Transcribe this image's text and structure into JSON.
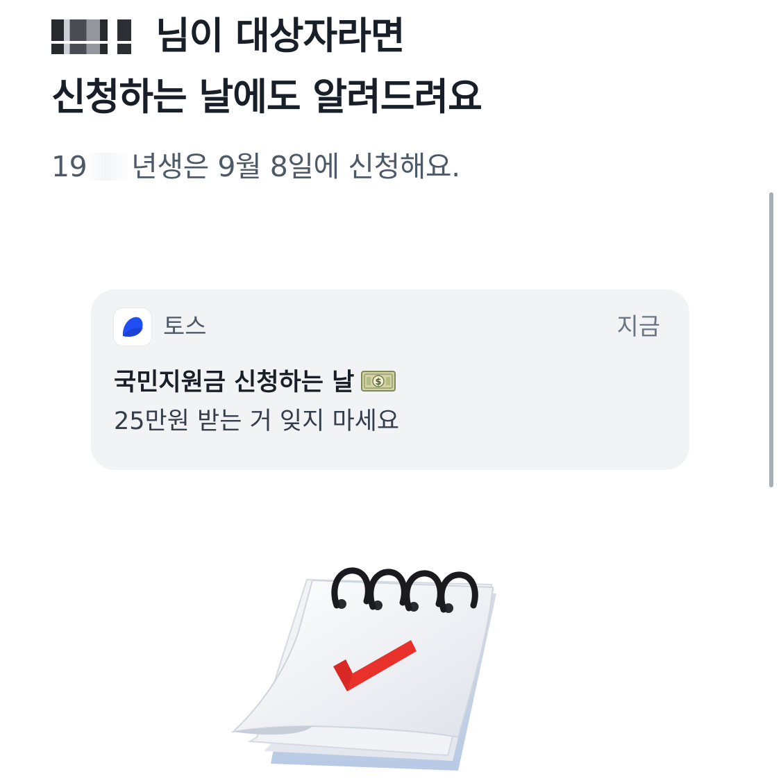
{
  "header": {
    "name_suffix": "님이 대상자라면",
    "line2": "신청하는 날에도 알려드려요",
    "sub_year_prefix": "19",
    "sub_rest": "년생은 9월 8일에 신청해요."
  },
  "notification": {
    "app_name": "토스",
    "time": "지금",
    "title": "국민지원금 신청하는 날",
    "body": "25만원 받는 거 잊지 마세요",
    "title_emoji_icon": "money-bill-icon"
  },
  "illustration": {
    "icon": "calendar-check-icon",
    "check_color": "#e8312b",
    "ring_color": "#1b1b1f"
  },
  "colors": {
    "brand": "#1f4ef5",
    "card_bg": "#f2f3f5",
    "text_primary": "#191f28",
    "text_secondary": "#4e5968"
  }
}
